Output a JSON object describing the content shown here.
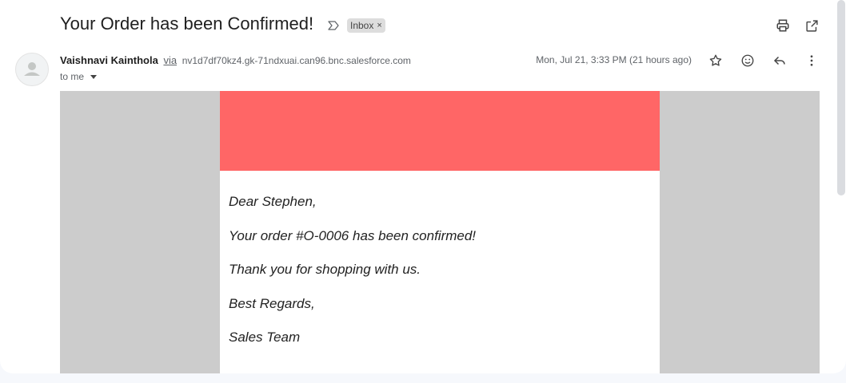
{
  "email": {
    "subject": "Your Order has been Confirmed!",
    "label": "Inbox",
    "label_close": "×",
    "sender_name": "Vaishnavi Kainthola",
    "via": "via",
    "sender_address": "nv1d7df70kz4.gk-71ndxuai.can96.bnc.salesforce.com",
    "to": "to me",
    "date": "Mon, Jul 21, 3:33 PM (21 hours ago)"
  },
  "body": {
    "banner_color": "#ff6666",
    "greeting": "Dear Stephen,",
    "line1": "Your order #O-0006 has been confirmed!",
    "line2": "Thank you for shopping with us.",
    "closing": "Best Regards,",
    "signature": "Sales Team"
  },
  "icons": {
    "important": "important-marker-icon",
    "print": "print-icon",
    "popout": "open-in-new-window-icon",
    "star": "star-icon",
    "emoji": "emoji-reaction-icon",
    "reply": "reply-icon",
    "more": "more-options-icon"
  }
}
